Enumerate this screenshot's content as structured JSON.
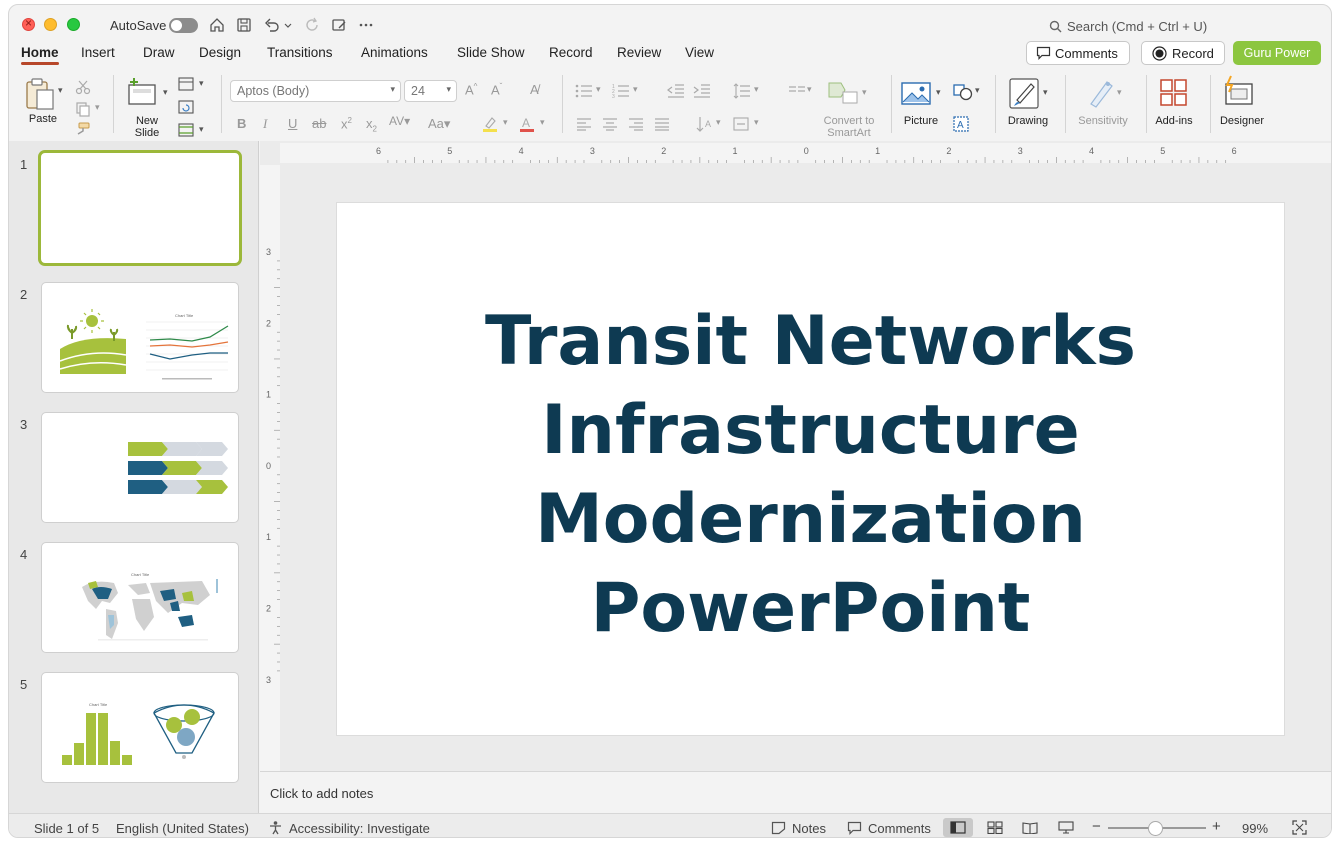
{
  "titlebar": {
    "autosave_label": "AutoSave",
    "autosave_on": false,
    "search_placeholder": "Search (Cmd + Ctrl + U)"
  },
  "tabs": [
    "Home",
    "Insert",
    "Draw",
    "Design",
    "Transitions",
    "Animations",
    "Slide Show",
    "Record",
    "Review",
    "View"
  ],
  "active_tab": "Home",
  "header_buttons": {
    "comments": "Comments",
    "record": "Record",
    "guru": "Guru Power"
  },
  "ribbon": {
    "paste": "Paste",
    "new_slide_1": "New",
    "new_slide_2": "Slide",
    "font_name": "Aptos (Body)",
    "font_size": "24",
    "convert_1": "Convert to",
    "convert_2": "SmartArt",
    "picture": "Picture",
    "drawing": "Drawing",
    "sensitivity": "Sensitivity",
    "addins": "Add-ins",
    "designer": "Designer"
  },
  "thumbnails": [
    {
      "number": "1"
    },
    {
      "number": "2",
      "chart_title": "Chart Title"
    },
    {
      "number": "3"
    },
    {
      "number": "4",
      "chart_title": "Chart Title"
    },
    {
      "number": "5",
      "chart_title": "Chart Title"
    }
  ],
  "slide": {
    "title_lines": [
      "Transit Networks",
      "Infrastructure",
      "Modernization",
      "PowerPoint"
    ]
  },
  "ruler": {
    "h_labels": [
      "6",
      "5",
      "4",
      "3",
      "2",
      "1",
      "0",
      "1",
      "2",
      "3",
      "4",
      "5",
      "6"
    ],
    "v_labels": [
      "3",
      "2",
      "1",
      "0",
      "1",
      "2",
      "3"
    ]
  },
  "notes_placeholder": "Click to add notes",
  "status": {
    "slide_info": "Slide 1 of 5",
    "language": "English (United States)",
    "accessibility": "Accessibility: Investigate",
    "notes": "Notes",
    "comments": "Comments",
    "zoom": "99%"
  },
  "colors": {
    "accent_tab": "#b7472a",
    "guru_button": "#8cc63f",
    "title_text": "#0e3a52",
    "thumb_selected": "#9cb83a"
  }
}
